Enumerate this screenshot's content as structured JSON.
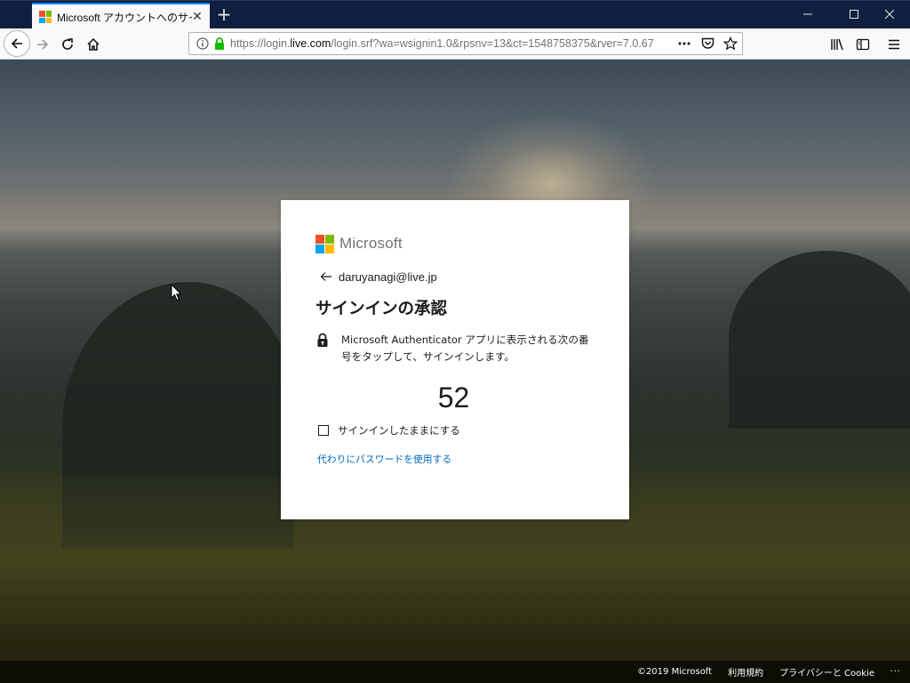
{
  "browser": {
    "tab": {
      "title": "Microsoft アカウントへのサインイン",
      "close_glyph": "✕"
    },
    "new_tab_glyph": "+",
    "window_controls": {
      "minimize": "—",
      "maximize": "☐",
      "close": "✕"
    },
    "url": {
      "prefix": "https://login.",
      "domain": "live.com",
      "path": "/login.srf?wa=wsignin1.0&rpsnv=13&ct=1548758375&rver=7.0.67"
    },
    "icons": [
      "back-arrow-icon",
      "forward-arrow-icon",
      "reload-icon",
      "home-icon",
      "info-icon",
      "lock-icon",
      "more-actions-icon",
      "pocket-icon",
      "bookmark-star-icon",
      "library-icon",
      "sidebar-icon",
      "hamburger-menu-icon"
    ]
  },
  "card": {
    "brand": "Microsoft",
    "brand_colors": [
      "#f25022",
      "#7fba00",
      "#00a4ef",
      "#ffb900"
    ],
    "identity_email": "daruyanagi@live.jp",
    "title": "サインインの承認",
    "instruction": "Microsoft Authenticator アプリに表示される次の番号をタップして、サインインします。",
    "code": "52",
    "keep_signed_in_label": "サインインしたままにする",
    "use_password_link": "代わりにパスワードを使用する",
    "link_color": "#0067b8"
  },
  "footer": {
    "copyright": "©2019 Microsoft",
    "terms": "利用規約",
    "privacy": "プライバシーと Cookie",
    "more": "..."
  }
}
